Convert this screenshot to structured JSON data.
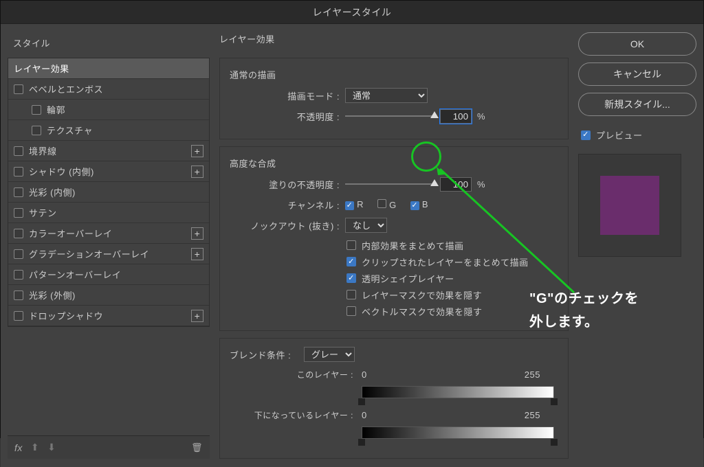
{
  "title": "レイヤースタイル",
  "left_head": "スタイル",
  "styles": [
    {
      "label": "レイヤー効果",
      "checkbox": false,
      "selected": true,
      "indent": 0,
      "plus": false
    },
    {
      "label": "ベベルとエンボス",
      "checkbox": true,
      "checked": false,
      "indent": 0,
      "plus": false
    },
    {
      "label": "輪郭",
      "checkbox": true,
      "checked": false,
      "indent": 1,
      "plus": false
    },
    {
      "label": "テクスチャ",
      "checkbox": true,
      "checked": false,
      "indent": 1,
      "plus": false
    },
    {
      "label": "境界線",
      "checkbox": true,
      "checked": false,
      "indent": 0,
      "plus": true
    },
    {
      "label": "シャドウ (内側)",
      "checkbox": true,
      "checked": false,
      "indent": 0,
      "plus": true
    },
    {
      "label": "光彩 (内側)",
      "checkbox": true,
      "checked": false,
      "indent": 0,
      "plus": false
    },
    {
      "label": "サテン",
      "checkbox": true,
      "checked": false,
      "indent": 0,
      "plus": false
    },
    {
      "label": "カラーオーバーレイ",
      "checkbox": true,
      "checked": false,
      "indent": 0,
      "plus": true
    },
    {
      "label": "グラデーションオーバーレイ",
      "checkbox": true,
      "checked": false,
      "indent": 0,
      "plus": true
    },
    {
      "label": "パターンオーバーレイ",
      "checkbox": true,
      "checked": false,
      "indent": 0,
      "plus": false
    },
    {
      "label": "光彩 (外側)",
      "checkbox": true,
      "checked": false,
      "indent": 0,
      "plus": false
    },
    {
      "label": "ドロップシャドウ",
      "checkbox": true,
      "checked": false,
      "indent": 0,
      "plus": true
    }
  ],
  "footer": {
    "fx": "fx",
    "trash_icon": "trash"
  },
  "mid": {
    "heading": "レイヤー効果",
    "normal_section": "通常の描画",
    "blend_mode_label": "描画モード :",
    "blend_mode_value": "通常",
    "opacity_label": "不透明度 :",
    "opacity_value": "100",
    "opacity_unit": "%",
    "advanced_section": "高度な合成",
    "fill_opacity_label": "塗りの不透明度 :",
    "fill_opacity_value": "100",
    "fill_opacity_unit": "%",
    "channels_label": "チャンネル :",
    "ch_r": {
      "label": "R",
      "checked": true
    },
    "ch_g": {
      "label": "G",
      "checked": false
    },
    "ch_b": {
      "label": "B",
      "checked": true
    },
    "knockout_label": "ノックアウト (抜き) :",
    "knockout_value": "なし",
    "adv_checks": [
      {
        "id": "adv1",
        "label": "内部効果をまとめて描画",
        "checked": false
      },
      {
        "id": "adv2",
        "label": "クリップされたレイヤーをまとめて描画",
        "checked": true
      },
      {
        "id": "adv3",
        "label": "透明シェイプレイヤー",
        "checked": true
      },
      {
        "id": "adv4",
        "label": "レイヤーマスクで効果を隠す",
        "checked": false
      },
      {
        "id": "adv5",
        "label": "ベクトルマスクで効果を隠す",
        "checked": false
      }
    ],
    "blendif_label": "ブレンド条件 :",
    "blendif_value": "グレー",
    "this_layer_label": "このレイヤー :",
    "this_black": "0",
    "this_white": "255",
    "under_layer_label": "下になっているレイヤー :",
    "under_black": "0",
    "under_white": "255"
  },
  "right": {
    "ok": "OK",
    "cancel": "キャンセル",
    "new_style": "新規スタイル...",
    "preview_label": "プレビュー",
    "preview_checked": true
  },
  "annotation": {
    "line1": "\"G\"のチェックを",
    "line2": "外します。"
  }
}
